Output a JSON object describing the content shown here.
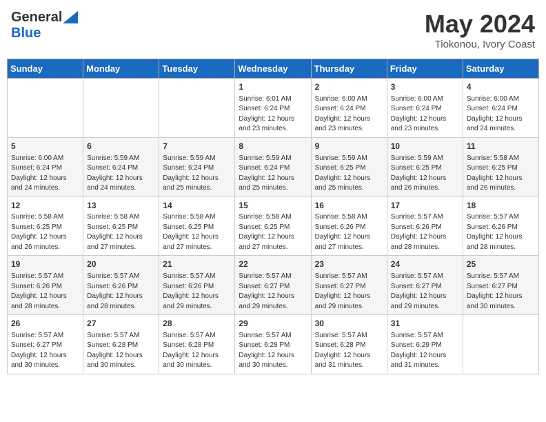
{
  "header": {
    "logo_general": "General",
    "logo_blue": "Blue",
    "month": "May 2024",
    "location": "Tiokonou, Ivory Coast"
  },
  "weekdays": [
    "Sunday",
    "Monday",
    "Tuesday",
    "Wednesday",
    "Thursday",
    "Friday",
    "Saturday"
  ],
  "weeks": [
    [
      {
        "day": "",
        "info": ""
      },
      {
        "day": "",
        "info": ""
      },
      {
        "day": "",
        "info": ""
      },
      {
        "day": "1",
        "info": "Sunrise: 6:01 AM\nSunset: 6:24 PM\nDaylight: 12 hours\nand 23 minutes."
      },
      {
        "day": "2",
        "info": "Sunrise: 6:00 AM\nSunset: 6:24 PM\nDaylight: 12 hours\nand 23 minutes."
      },
      {
        "day": "3",
        "info": "Sunrise: 6:00 AM\nSunset: 6:24 PM\nDaylight: 12 hours\nand 23 minutes."
      },
      {
        "day": "4",
        "info": "Sunrise: 6:00 AM\nSunset: 6:24 PM\nDaylight: 12 hours\nand 24 minutes."
      }
    ],
    [
      {
        "day": "5",
        "info": "Sunrise: 6:00 AM\nSunset: 6:24 PM\nDaylight: 12 hours\nand 24 minutes."
      },
      {
        "day": "6",
        "info": "Sunrise: 5:59 AM\nSunset: 6:24 PM\nDaylight: 12 hours\nand 24 minutes."
      },
      {
        "day": "7",
        "info": "Sunrise: 5:59 AM\nSunset: 6:24 PM\nDaylight: 12 hours\nand 25 minutes."
      },
      {
        "day": "8",
        "info": "Sunrise: 5:59 AM\nSunset: 6:24 PM\nDaylight: 12 hours\nand 25 minutes."
      },
      {
        "day": "9",
        "info": "Sunrise: 5:59 AM\nSunset: 6:25 PM\nDaylight: 12 hours\nand 25 minutes."
      },
      {
        "day": "10",
        "info": "Sunrise: 5:59 AM\nSunset: 6:25 PM\nDaylight: 12 hours\nand 26 minutes."
      },
      {
        "day": "11",
        "info": "Sunrise: 5:58 AM\nSunset: 6:25 PM\nDaylight: 12 hours\nand 26 minutes."
      }
    ],
    [
      {
        "day": "12",
        "info": "Sunrise: 5:58 AM\nSunset: 6:25 PM\nDaylight: 12 hours\nand 26 minutes."
      },
      {
        "day": "13",
        "info": "Sunrise: 5:58 AM\nSunset: 6:25 PM\nDaylight: 12 hours\nand 27 minutes."
      },
      {
        "day": "14",
        "info": "Sunrise: 5:58 AM\nSunset: 6:25 PM\nDaylight: 12 hours\nand 27 minutes."
      },
      {
        "day": "15",
        "info": "Sunrise: 5:58 AM\nSunset: 6:25 PM\nDaylight: 12 hours\nand 27 minutes."
      },
      {
        "day": "16",
        "info": "Sunrise: 5:58 AM\nSunset: 6:26 PM\nDaylight: 12 hours\nand 27 minutes."
      },
      {
        "day": "17",
        "info": "Sunrise: 5:57 AM\nSunset: 6:26 PM\nDaylight: 12 hours\nand 28 minutes."
      },
      {
        "day": "18",
        "info": "Sunrise: 5:57 AM\nSunset: 6:26 PM\nDaylight: 12 hours\nand 28 minutes."
      }
    ],
    [
      {
        "day": "19",
        "info": "Sunrise: 5:57 AM\nSunset: 6:26 PM\nDaylight: 12 hours\nand 28 minutes."
      },
      {
        "day": "20",
        "info": "Sunrise: 5:57 AM\nSunset: 6:26 PM\nDaylight: 12 hours\nand 28 minutes."
      },
      {
        "day": "21",
        "info": "Sunrise: 5:57 AM\nSunset: 6:26 PM\nDaylight: 12 hours\nand 29 minutes."
      },
      {
        "day": "22",
        "info": "Sunrise: 5:57 AM\nSunset: 6:27 PM\nDaylight: 12 hours\nand 29 minutes."
      },
      {
        "day": "23",
        "info": "Sunrise: 5:57 AM\nSunset: 6:27 PM\nDaylight: 12 hours\nand 29 minutes."
      },
      {
        "day": "24",
        "info": "Sunrise: 5:57 AM\nSunset: 6:27 PM\nDaylight: 12 hours\nand 29 minutes."
      },
      {
        "day": "25",
        "info": "Sunrise: 5:57 AM\nSunset: 6:27 PM\nDaylight: 12 hours\nand 30 minutes."
      }
    ],
    [
      {
        "day": "26",
        "info": "Sunrise: 5:57 AM\nSunset: 6:27 PM\nDaylight: 12 hours\nand 30 minutes."
      },
      {
        "day": "27",
        "info": "Sunrise: 5:57 AM\nSunset: 6:28 PM\nDaylight: 12 hours\nand 30 minutes."
      },
      {
        "day": "28",
        "info": "Sunrise: 5:57 AM\nSunset: 6:28 PM\nDaylight: 12 hours\nand 30 minutes."
      },
      {
        "day": "29",
        "info": "Sunrise: 5:57 AM\nSunset: 6:28 PM\nDaylight: 12 hours\nand 30 minutes."
      },
      {
        "day": "30",
        "info": "Sunrise: 5:57 AM\nSunset: 6:28 PM\nDaylight: 12 hours\nand 31 minutes."
      },
      {
        "day": "31",
        "info": "Sunrise: 5:57 AM\nSunset: 6:29 PM\nDaylight: 12 hours\nand 31 minutes."
      },
      {
        "day": "",
        "info": ""
      }
    ]
  ]
}
